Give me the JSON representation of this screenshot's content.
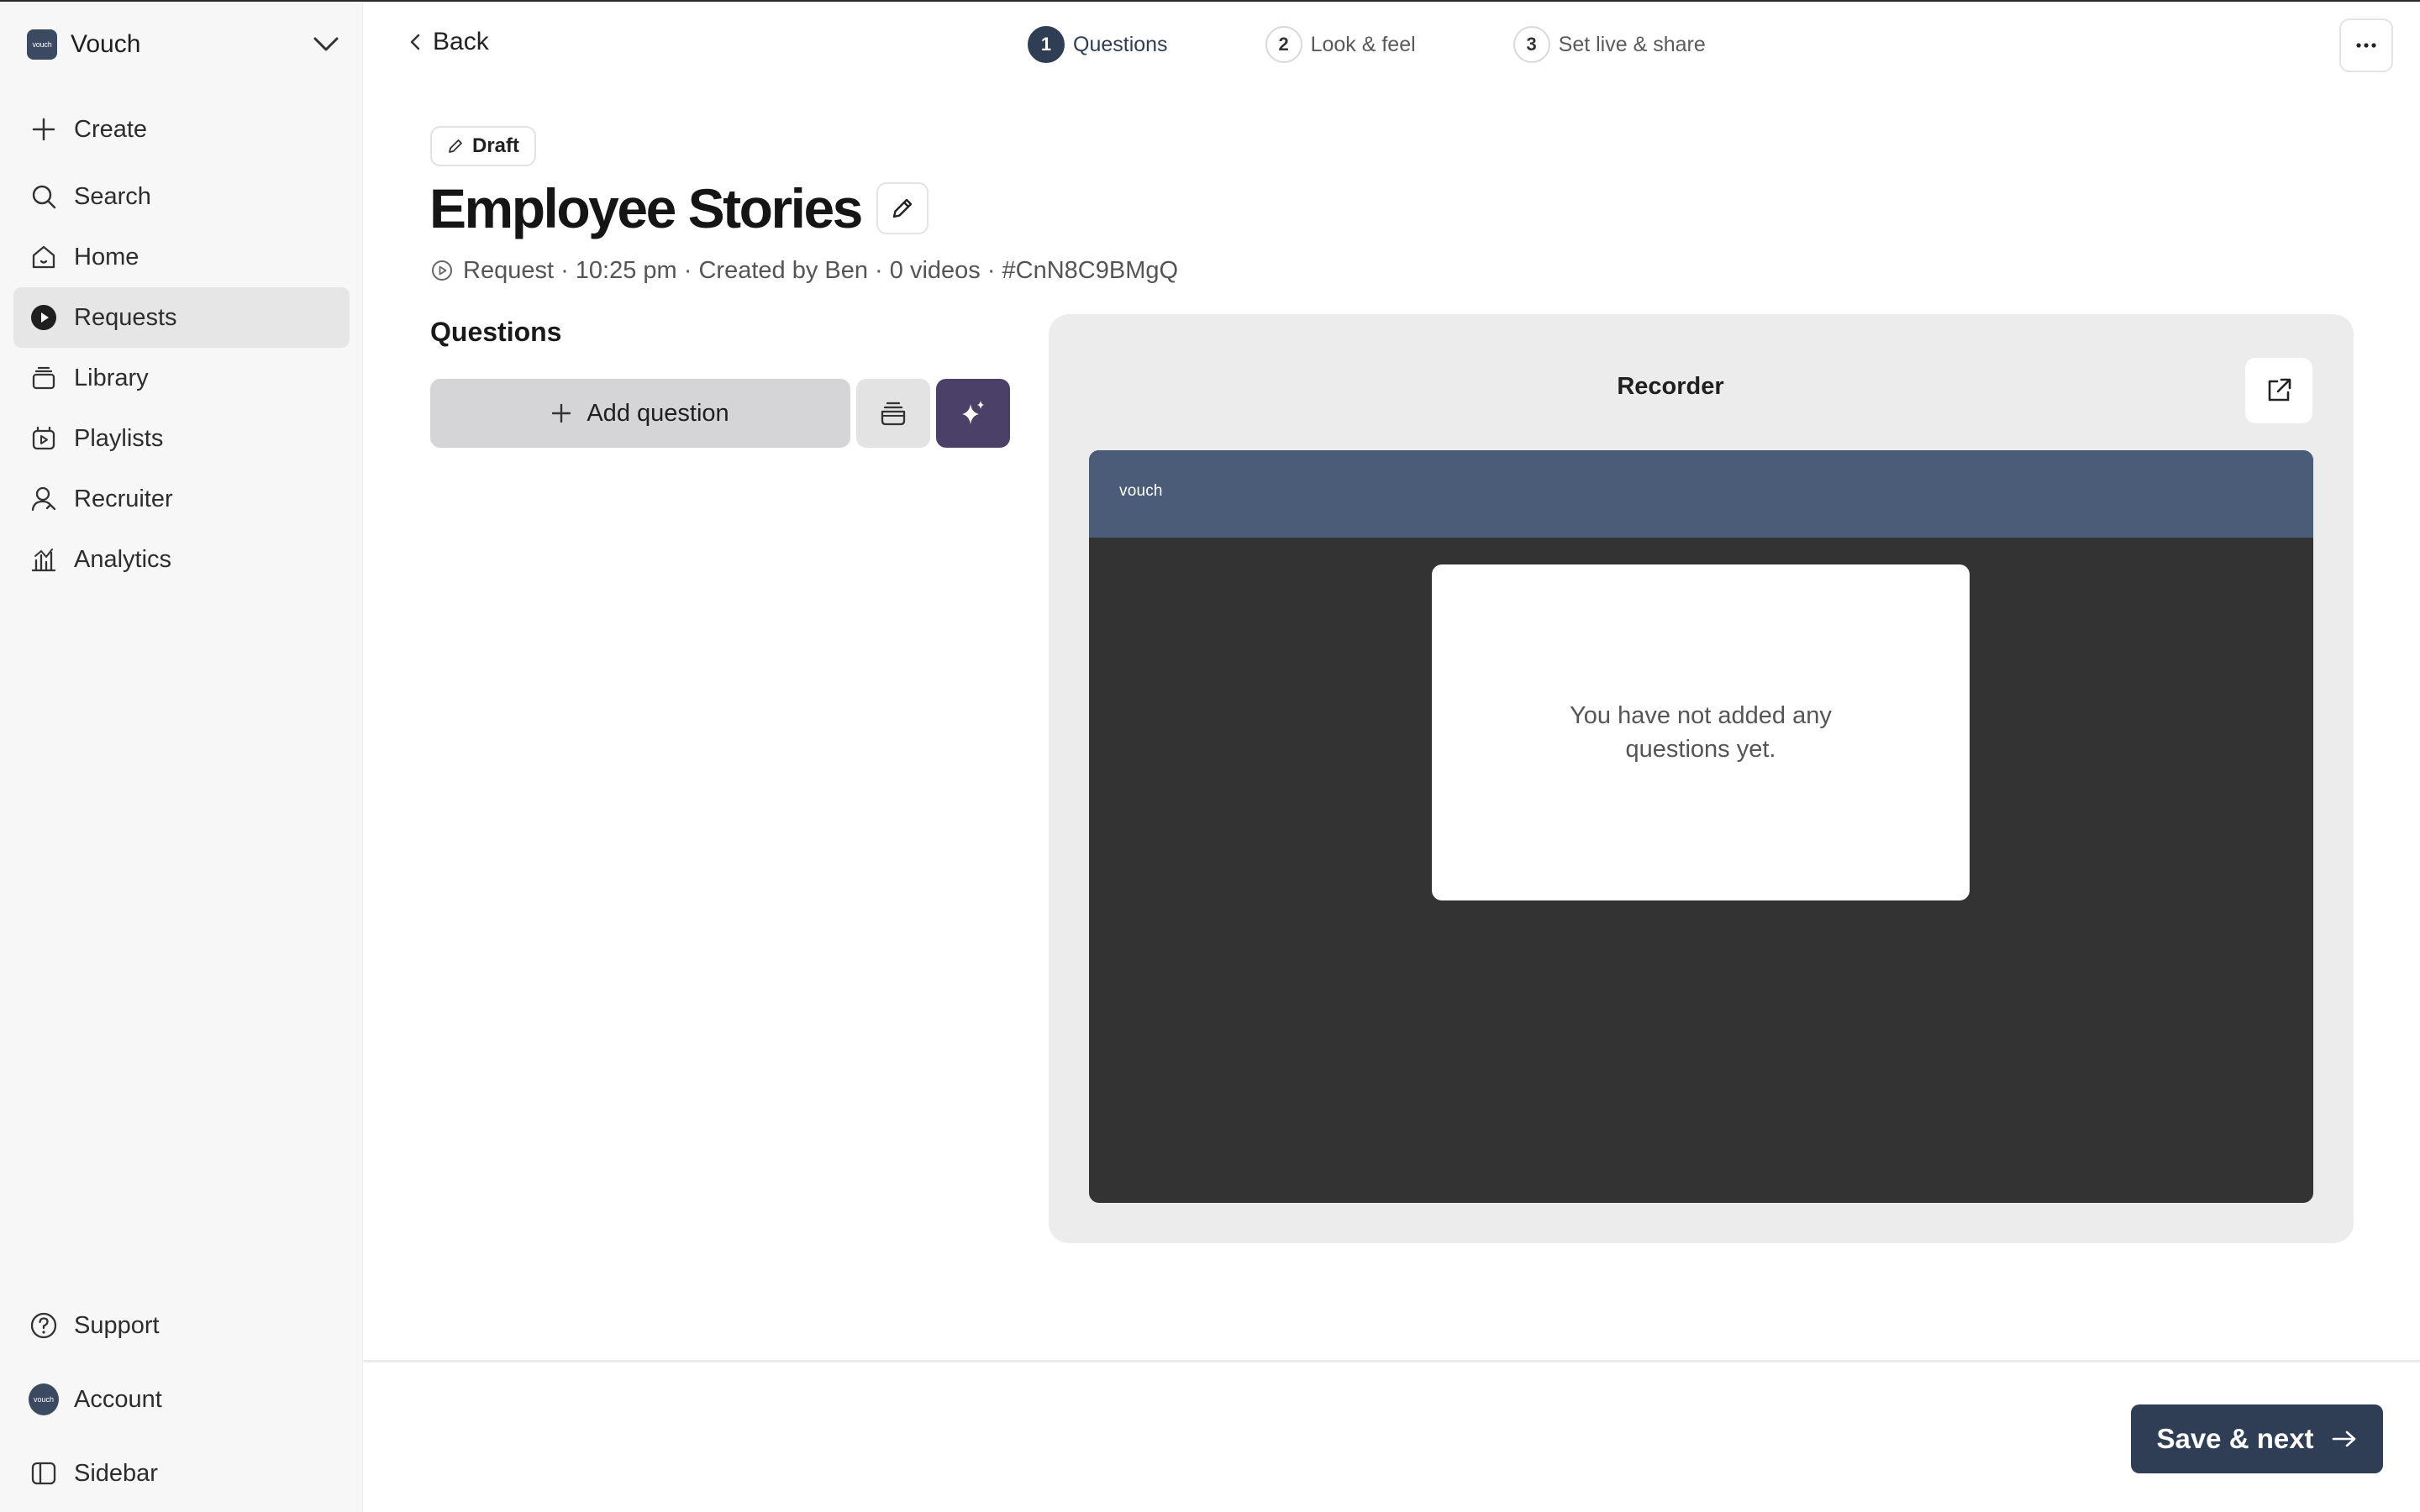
{
  "workspace": {
    "logo_text": "vouch",
    "name": "Vouch"
  },
  "nav": {
    "create": "Create",
    "search": "Search",
    "home": "Home",
    "requests": "Requests",
    "library": "Library",
    "playlists": "Playlists",
    "recruiter": "Recruiter",
    "analytics": "Analytics"
  },
  "sidebar_bottom": {
    "support": "Support",
    "account_avatar": "vouch",
    "account": "Account",
    "sidebar": "Sidebar"
  },
  "header": {
    "back_label": "Back",
    "steps": [
      {
        "number": "1",
        "label": "Questions",
        "state": "current"
      },
      {
        "number": "2",
        "label": "Look & feel",
        "state": "upcoming"
      },
      {
        "number": "3",
        "label": "Set live & share",
        "state": "upcoming"
      }
    ]
  },
  "page": {
    "status_badge": "Draft",
    "title": "Employee Stories",
    "meta": "Request · 10:25 pm · Created by Ben · 0 videos · #CnN8C9BMgQ"
  },
  "questions": {
    "heading": "Questions",
    "add_label": "Add question"
  },
  "preview": {
    "title": "Recorder",
    "brand_logo": "vouch",
    "empty_message": "You have not added any questions yet."
  },
  "footer": {
    "save_label": "Save & next"
  },
  "colors": {
    "primary": "#2f3e55",
    "ai_button": "#4b4168",
    "recorder_header": "#4a5c78",
    "recorder_body": "#333333"
  }
}
